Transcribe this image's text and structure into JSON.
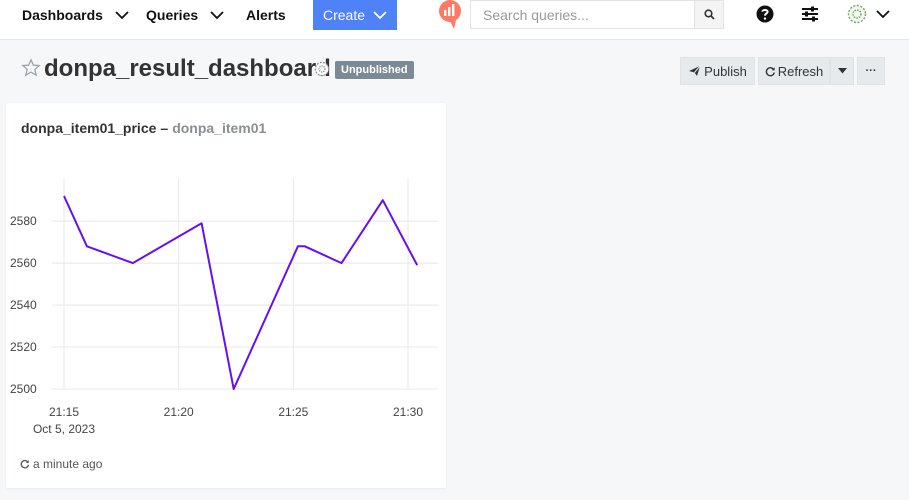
{
  "nav": {
    "dashboards": "Dashboards",
    "queries": "Queries",
    "alerts": "Alerts",
    "create": "Create",
    "search_placeholder": "Search queries..."
  },
  "header": {
    "title": "donpa_result_dashboard",
    "status_badge": "Unpublished",
    "publish_label": "Publish",
    "refresh_label": "Refresh",
    "more_label": "···"
  },
  "widget": {
    "query_name": "donpa_item01_price",
    "separator": "–",
    "data_source": "donpa_item01",
    "updated": "a minute ago"
  },
  "colors": {
    "accent": "#4e82f6",
    "series": "#6610f2",
    "logo": "#ff7964",
    "badge": "#7c8a96"
  },
  "chart_data": {
    "type": "line",
    "title": "",
    "xlabel": "",
    "ylabel": "",
    "x": [
      "21:15",
      "21:16",
      "21:18",
      "21:21",
      "21:22",
      "21:25",
      "21:25.3",
      "21:27",
      "21:29",
      "21:30.5"
    ],
    "x_minutes": [
      0,
      1,
      3,
      6,
      7.4,
      10.2,
      10.5,
      12.1,
      13.9,
      15.4
    ],
    "x_ticks": [
      "21:15",
      "21:20",
      "21:25",
      "21:30"
    ],
    "x_date": "Oct 5, 2023",
    "series": [
      {
        "values": [
          2592,
          2568,
          2560,
          2579,
          2500,
          2568,
          2568,
          2560,
          2590,
          2559
        ]
      }
    ],
    "ylim": [
      2500,
      2592
    ],
    "y_ticks": [
      2500,
      2520,
      2540,
      2560,
      2580
    ],
    "grid": true
  }
}
